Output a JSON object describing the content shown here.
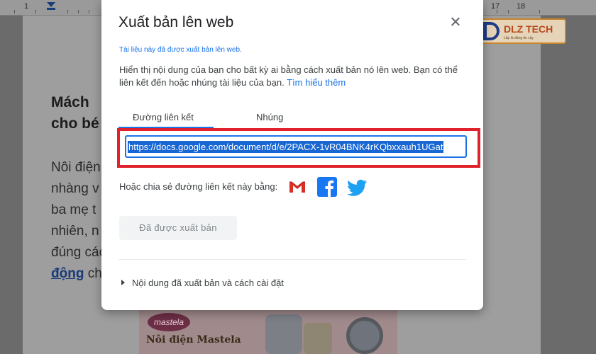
{
  "ruler": {
    "left_label": "1",
    "right_labels": [
      "17",
      "18"
    ]
  },
  "document": {
    "heading_lines": [
      "Mách",
      "cho bé"
    ],
    "paragraph_lines": [
      "Nôi điện",
      "nhàng v",
      "ba mẹ t",
      "nhiên, n",
      "đúng các"
    ],
    "link_text": "động",
    "link_suffix": " ch",
    "image": {
      "brand": "mastela",
      "caption": "Nôi điện Mastela"
    }
  },
  "badge": {
    "name": "DLZ TECH",
    "slogan": "Lắp là đáng tin cậy"
  },
  "dialog": {
    "title": "Xuất bản lên web",
    "published_note": "Tài liệu này đã được xuất bản lên web.",
    "description": "Hiển thị nội dung của bạn cho bất kỳ ai bằng cách xuất bản nó lên web. Bạn có thể liên kết đến hoặc nhúng tài liệu của bạn.",
    "learn_more": "Tìm hiểu thêm",
    "tabs": [
      "Đường liên kết",
      "Nhúng"
    ],
    "url": "https://docs.google.com/document/d/e/2PACX-1vR04BNK4rKQbxxauh1UGat",
    "share_label": "Hoặc chia sẻ đường liên kết này bằng:",
    "share_icons": [
      "gmail-icon",
      "facebook-icon",
      "twitter-icon"
    ],
    "published_button": "Đã được xuất bản",
    "settings_label": "Nội dung đã xuất bản và cách cài đặt"
  },
  "colors": {
    "accent": "#1a73e8",
    "highlight_frame": "#e1212b",
    "gmail": "#d93025",
    "facebook": "#1877f2",
    "twitter": "#1da1f2"
  }
}
